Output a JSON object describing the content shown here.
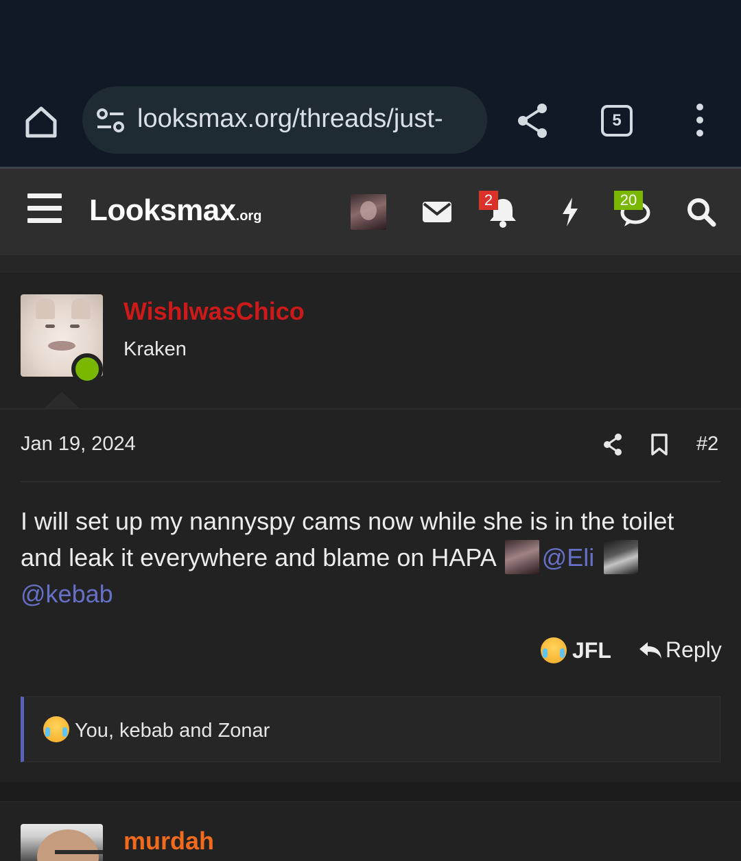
{
  "browser": {
    "url": "looksmax.org/threads/just-",
    "tab_count": "5"
  },
  "site_header": {
    "logo_main": "Looksmax",
    "logo_suffix": ".org",
    "alerts_count": "2",
    "conversations_count": "20"
  },
  "post": {
    "username": "WishIwasChico",
    "user_title": "Kraken",
    "date": "Jan 19, 2024",
    "post_number": "#2",
    "body_text": "I will set up my nannyspy cams now while she is in the toilet and leak it everywhere and blame on HAPA",
    "mentions": [
      "@Eli",
      "@kebab"
    ],
    "reaction_button": "JFL",
    "reply_button": "Reply",
    "reactions_summary": "You, kebab and Zonar"
  },
  "next_post": {
    "username": "murdah"
  },
  "colors": {
    "username_color": "#cc1a1a",
    "next_username_color": "#f26b1d",
    "mention_color": "#6670c7",
    "online_color": "#7ab800"
  }
}
